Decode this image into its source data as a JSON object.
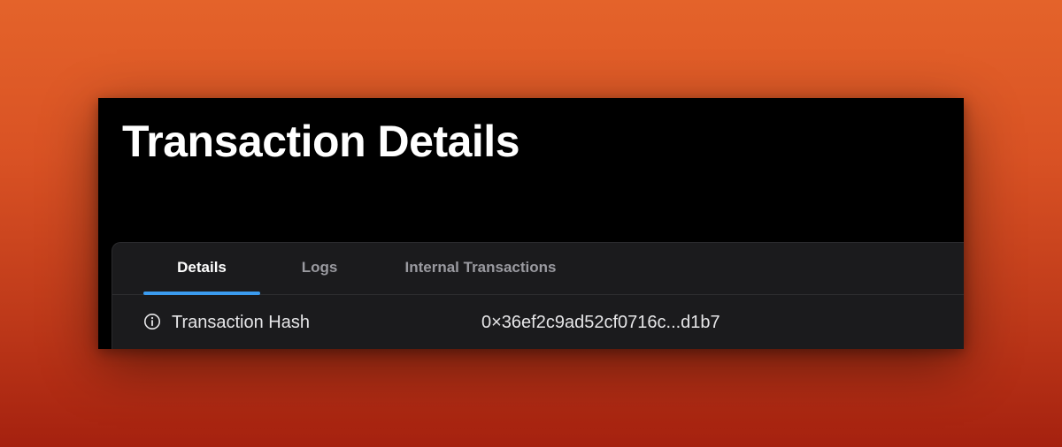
{
  "page": {
    "title": "Transaction Details"
  },
  "tabs": [
    {
      "label": "Details",
      "active": true
    },
    {
      "label": "Logs",
      "active": false
    },
    {
      "label": "Internal Transactions",
      "active": false
    }
  ],
  "details": {
    "rows": [
      {
        "icon": "info-icon",
        "label": "Transaction Hash",
        "value": "0×36ef2c9ad52cf0716c...d1b7"
      }
    ]
  },
  "colors": {
    "background_top": "#e4632a",
    "background_bottom": "#a5210f",
    "window": "#000000",
    "card": "#1b1b1d",
    "active_tab_indicator": "#3b9cf0",
    "inactive_tab_text": "#9a9aa0"
  }
}
